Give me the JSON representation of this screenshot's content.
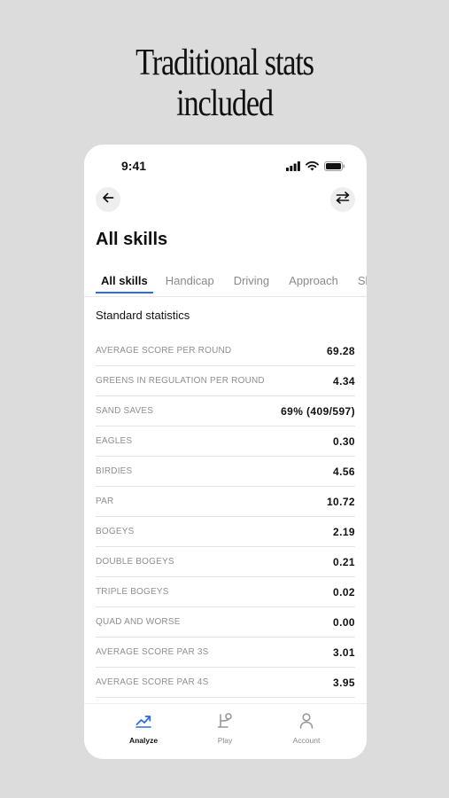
{
  "headline": {
    "line1": "Traditional stats",
    "line2": "included"
  },
  "status_bar": {
    "time": "9:41"
  },
  "header": {
    "title": "All skills"
  },
  "tabs": [
    {
      "label": "All skills",
      "active": true
    },
    {
      "label": "Handicap",
      "active": false
    },
    {
      "label": "Driving",
      "active": false
    },
    {
      "label": "Approach",
      "active": false
    },
    {
      "label": "Sho",
      "active": false
    }
  ],
  "section": {
    "title": "Standard statistics"
  },
  "stats": [
    {
      "label": "AVERAGE SCORE PER ROUND",
      "value": "69.28"
    },
    {
      "label": "GREENS IN REGULATION PER ROUND",
      "value": "4.34"
    },
    {
      "label": "SAND SAVES",
      "value": "69% (409/597)"
    },
    {
      "label": "EAGLES",
      "value": "0.30"
    },
    {
      "label": "BIRDIES",
      "value": "4.56"
    },
    {
      "label": "PAR",
      "value": "10.72"
    },
    {
      "label": "BOGEYS",
      "value": "2.19"
    },
    {
      "label": "DOUBLE BOGEYS",
      "value": "0.21"
    },
    {
      "label": "TRIPLE BOGEYS",
      "value": "0.02"
    },
    {
      "label": "QUAD AND WORSE",
      "value": "0.00"
    },
    {
      "label": "AVERAGE SCORE PAR 3S",
      "value": "3.01"
    },
    {
      "label": "AVERAGE SCORE PAR 4S",
      "value": "3.95"
    }
  ],
  "bottom_nav": [
    {
      "label": "Analyze",
      "icon": "trend-up-icon",
      "active": true
    },
    {
      "label": "Play",
      "icon": "play-golf-icon",
      "active": false
    },
    {
      "label": "Account",
      "icon": "person-icon",
      "active": false
    }
  ],
  "colors": {
    "accent": "#2b6be6",
    "background": "#dcdcdc"
  }
}
